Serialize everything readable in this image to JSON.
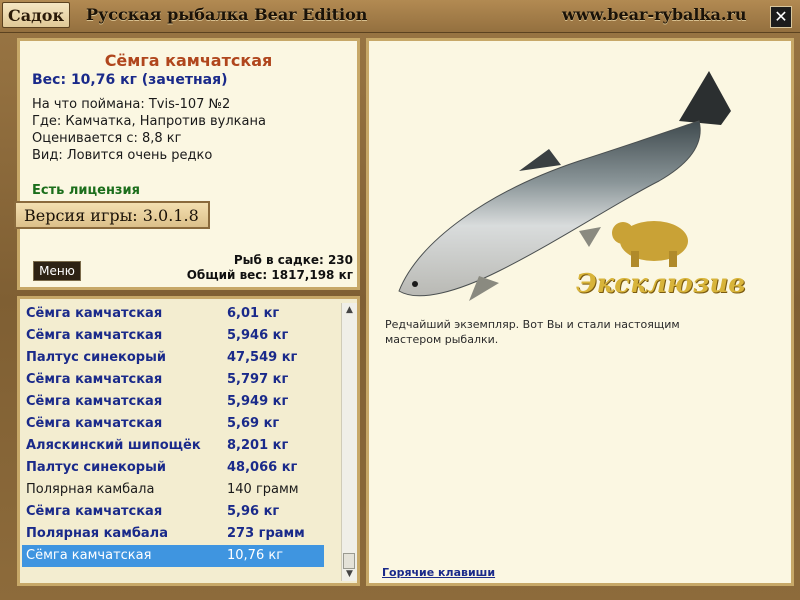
{
  "window": {
    "sadok_label": "Садок",
    "title": "Русская рыбалка Bear Edition",
    "site_url": "www.bear-rybalka.ru",
    "close_glyph": "✕"
  },
  "catch_info": {
    "fish_name": "Сёмга камчатская",
    "weight": "Вес: 10,76 кг (зачетная)",
    "caught_on": "На что поймана: Tvis-107 №2",
    "location": "Где: Камчатка, Напротив вулкана",
    "valued_from": "Оценивается с: 8,8 кг",
    "rarity": "Вид: Ловится очень редко",
    "license": "Есть лицензия"
  },
  "version": "Версия игры: 3.0.1.8",
  "menu_label": "Меню",
  "stats": {
    "fish_count": "Рыб в садке: 230",
    "total_weight": "Общий вес: 1817,198 кг"
  },
  "fish_list": [
    {
      "name": "Сёмга камчатская",
      "weight": "6,01 кг",
      "style": "blue"
    },
    {
      "name": "Сёмга камчатская",
      "weight": "5,946 кг",
      "style": "blue"
    },
    {
      "name": "Палтус синекорый",
      "weight": "47,549 кг",
      "style": "blue"
    },
    {
      "name": "Сёмга камчатская",
      "weight": "5,797 кг",
      "style": "blue"
    },
    {
      "name": "Сёмга камчатская",
      "weight": "5,949 кг",
      "style": "blue"
    },
    {
      "name": "Сёмга камчатская",
      "weight": "5,69 кг",
      "style": "blue"
    },
    {
      "name": "Аляскинский шипощёк",
      "weight": "8,201 кг",
      "style": "blue"
    },
    {
      "name": "Палтус синекорый",
      "weight": "48,066 кг",
      "style": "blue"
    },
    {
      "name": "Полярная камбала",
      "weight": "140 грамм",
      "style": "plain"
    },
    {
      "name": "Сёмга камчатская",
      "weight": "5,96 кг",
      "style": "blue"
    },
    {
      "name": "Полярная камбала",
      "weight": "273 грамм",
      "style": "blue"
    },
    {
      "name": "Сёмга камчатская",
      "weight": "10,76 кг",
      "style": "selected"
    }
  ],
  "exclusive_badge": "Эксклюзив",
  "description": "Редчайший экземпляр. Вот Вы и стали настоящим мастером рыбалки.",
  "hotkeys_label": "Горячие клавиши",
  "colors": {
    "accent_name": "#b0461d",
    "list_blue": "#1a2a8a",
    "selected_row": "#3f95e0",
    "license_green": "#1b6e1b",
    "panel_border": "#c7a868"
  }
}
